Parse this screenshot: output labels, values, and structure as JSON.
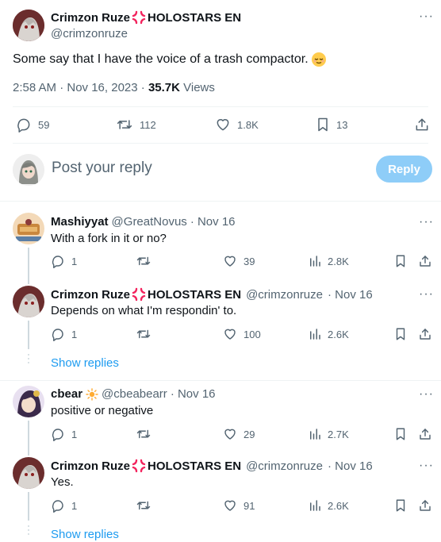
{
  "main_tweet": {
    "author_name": "Crimzon Ruze",
    "author_affiliation": "HOLOSTARS EN",
    "author_handle": "@crimzonruze",
    "text": "Some say that I have the voice of a trash compactor.",
    "time": "2:58 AM · Nov 16, 2023 · ",
    "views_count": "35.7K",
    "views_label": " Views",
    "replies": "59",
    "retweets": "112",
    "likes": "1.8K",
    "bookmarks": "13"
  },
  "composer": {
    "placeholder": "Post your reply",
    "button_label": "Reply"
  },
  "replies": [
    {
      "author_name": "Mashiyyat",
      "author_handle": "@GreatNovus",
      "date": "· Nov 16",
      "text": "With a fork in it or no?",
      "replies": "1",
      "likes": "39",
      "views": "2.8K"
    },
    {
      "author_name": "Crimzon Ruze",
      "author_affiliation": "HOLOSTARS EN",
      "author_handle": "@crimzonruze",
      "date": "· Nov 16",
      "text": "Depends on what I'm respondin' to.",
      "replies": "1",
      "likes": "100",
      "views": "2.6K"
    },
    {
      "author_name": "cbear",
      "author_handle": "@cbeabearr",
      "date": "· Nov 16",
      "text": "positive or negative",
      "replies": "1",
      "likes": "29",
      "views": "2.7K"
    },
    {
      "author_name": "Crimzon Ruze",
      "author_affiliation": "HOLOSTARS EN",
      "author_handle": "@crimzonruze",
      "date": "· Nov 16",
      "text": "Yes.",
      "replies": "1",
      "likes": "91",
      "views": "2.6K"
    }
  ],
  "show_replies_label": "Show replies",
  "more_label": "···",
  "colors": {
    "accent": "#1d9bf0",
    "reply_button_disabled": "#8ecdf8",
    "text_secondary": "#536471",
    "anger_icon": "#f4245e"
  }
}
